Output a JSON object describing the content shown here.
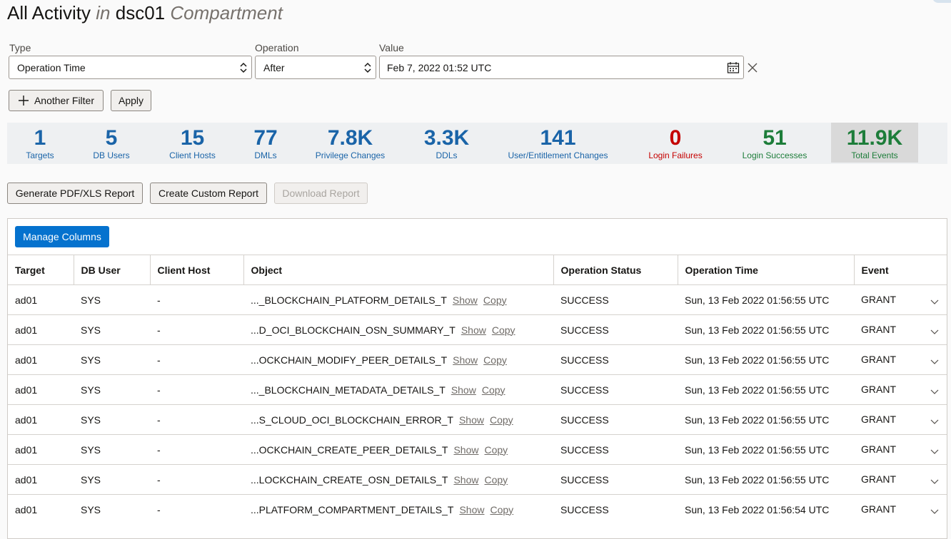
{
  "header": {
    "title": "All Activity",
    "in_word": "in",
    "compartment": "dsc01",
    "compartment_word": "Compartment"
  },
  "filters": {
    "type_label": "Type",
    "type_value": "Operation Time",
    "operation_label": "Operation",
    "operation_value": "After",
    "value_label": "Value",
    "value_value": "Feb 7, 2022 01:52 UTC",
    "another_filter_label": "Another Filter",
    "apply_label": "Apply"
  },
  "stats": [
    {
      "value": "1",
      "label": "Targets"
    },
    {
      "value": "5",
      "label": "DB Users"
    },
    {
      "value": "15",
      "label": "Client Hosts"
    },
    {
      "value": "77",
      "label": "DMLs"
    },
    {
      "value": "7.8K",
      "label": "Privilege Changes"
    },
    {
      "value": "3.3K",
      "label": "DDLs"
    },
    {
      "value": "141",
      "label": "User/Entitlement Changes"
    },
    {
      "value": "0",
      "label": "Login Failures"
    },
    {
      "value": "51",
      "label": "Login Successes"
    },
    {
      "value": "11.9K",
      "label": "Total Events"
    }
  ],
  "reports": {
    "generate_label": "Generate PDF/XLS Report",
    "custom_label": "Create Custom Report",
    "download_label": "Download Report"
  },
  "table": {
    "manage_columns_label": "Manage Columns",
    "columns": [
      "Target",
      "DB User",
      "Client Host",
      "Object",
      "Operation Status",
      "Operation Time",
      "Event"
    ],
    "show_label": "Show",
    "copy_label": "Copy",
    "rows": [
      {
        "target": "ad01",
        "db_user": "SYS",
        "client_host": "-",
        "object": "..._BLOCKCHAIN_PLATFORM_DETAILS_T",
        "status": "SUCCESS",
        "time": "Sun, 13 Feb 2022 01:56:55 UTC",
        "event": "GRANT"
      },
      {
        "target": "ad01",
        "db_user": "SYS",
        "client_host": "-",
        "object": "...D_OCI_BLOCKCHAIN_OSN_SUMMARY_T",
        "status": "SUCCESS",
        "time": "Sun, 13 Feb 2022 01:56:55 UTC",
        "event": "GRANT"
      },
      {
        "target": "ad01",
        "db_user": "SYS",
        "client_host": "-",
        "object": "...OCKCHAIN_MODIFY_PEER_DETAILS_T",
        "status": "SUCCESS",
        "time": "Sun, 13 Feb 2022 01:56:55 UTC",
        "event": "GRANT"
      },
      {
        "target": "ad01",
        "db_user": "SYS",
        "client_host": "-",
        "object": "..._BLOCKCHAIN_METADATA_DETAILS_T",
        "status": "SUCCESS",
        "time": "Sun, 13 Feb 2022 01:56:55 UTC",
        "event": "GRANT"
      },
      {
        "target": "ad01",
        "db_user": "SYS",
        "client_host": "-",
        "object": "...S_CLOUD_OCI_BLOCKCHAIN_ERROR_T",
        "status": "SUCCESS",
        "time": "Sun, 13 Feb 2022 01:56:55 UTC",
        "event": "GRANT"
      },
      {
        "target": "ad01",
        "db_user": "SYS",
        "client_host": "-",
        "object": "...OCKCHAIN_CREATE_PEER_DETAILS_T",
        "status": "SUCCESS",
        "time": "Sun, 13 Feb 2022 01:56:55 UTC",
        "event": "GRANT"
      },
      {
        "target": "ad01",
        "db_user": "SYS",
        "client_host": "-",
        "object": "...LOCKCHAIN_CREATE_OSN_DETAILS_T",
        "status": "SUCCESS",
        "time": "Sun, 13 Feb 2022 01:56:55 UTC",
        "event": "GRANT"
      },
      {
        "target": "ad01",
        "db_user": "SYS",
        "client_host": "-",
        "object": "...PLATFORM_COMPARTMENT_DETAILS_T",
        "status": "SUCCESS",
        "time": "Sun, 13 Feb 2022 01:56:54 UTC",
        "event": "GRANT"
      }
    ]
  },
  "icons": {
    "select_chevrons": "chevron-up-down-icon",
    "calendar": "calendar-icon",
    "clear": "close-icon",
    "add": "plus-icon",
    "row_expand": "chevron-down-icon"
  },
  "colors": {
    "primary": "#0572ce",
    "stat_blue": "#1a64a8",
    "stat_red": "#c50000",
    "stat_green": "#1d7d3a"
  }
}
